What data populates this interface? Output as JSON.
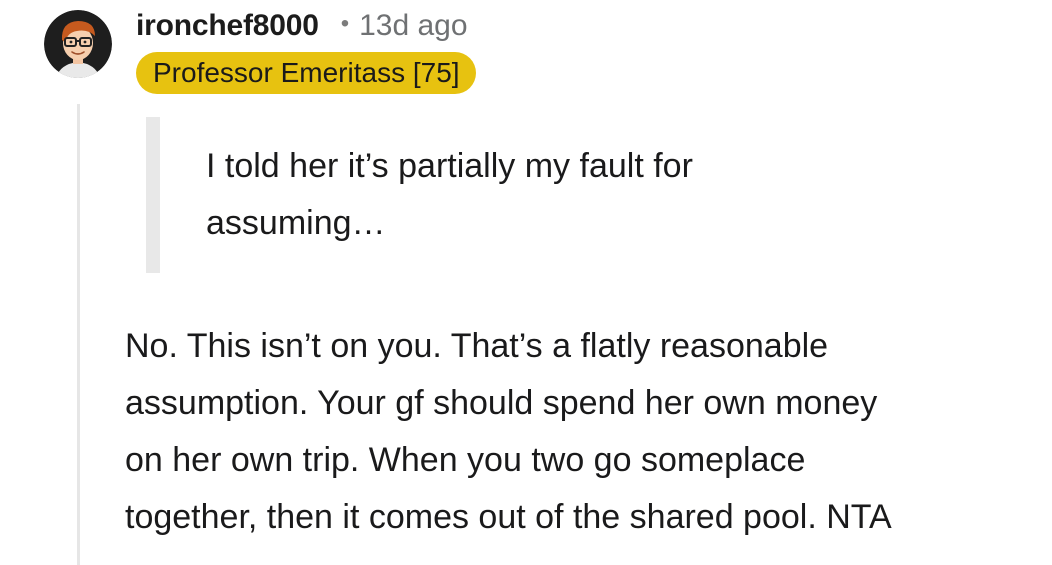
{
  "comment": {
    "author": "ironchef8000",
    "separator": "•",
    "age": "13d ago",
    "flair": "Professor Emeritass [75]",
    "quote_line_1": "I told her it’s partially my fault for",
    "quote_line_2": "assuming…",
    "body_line_1": "No. This isn’t on you. That’s a flatly reasonable",
    "body_line_2": "assumption. Your gf should spend her own money",
    "body_line_3": "on her own trip. When you two go someplace",
    "body_line_4": "together, then it comes out of the shared pool. NTA"
  },
  "colors": {
    "flair_background": "#e7c210",
    "thread_line": "#e6e6e6",
    "quote_bar": "#e8e8e8",
    "avatar_background": "#1e1e1e",
    "avatar_hair": "#c65a1e"
  },
  "icons": {
    "avatar": "cartoon-face-with-glasses-avatar"
  }
}
